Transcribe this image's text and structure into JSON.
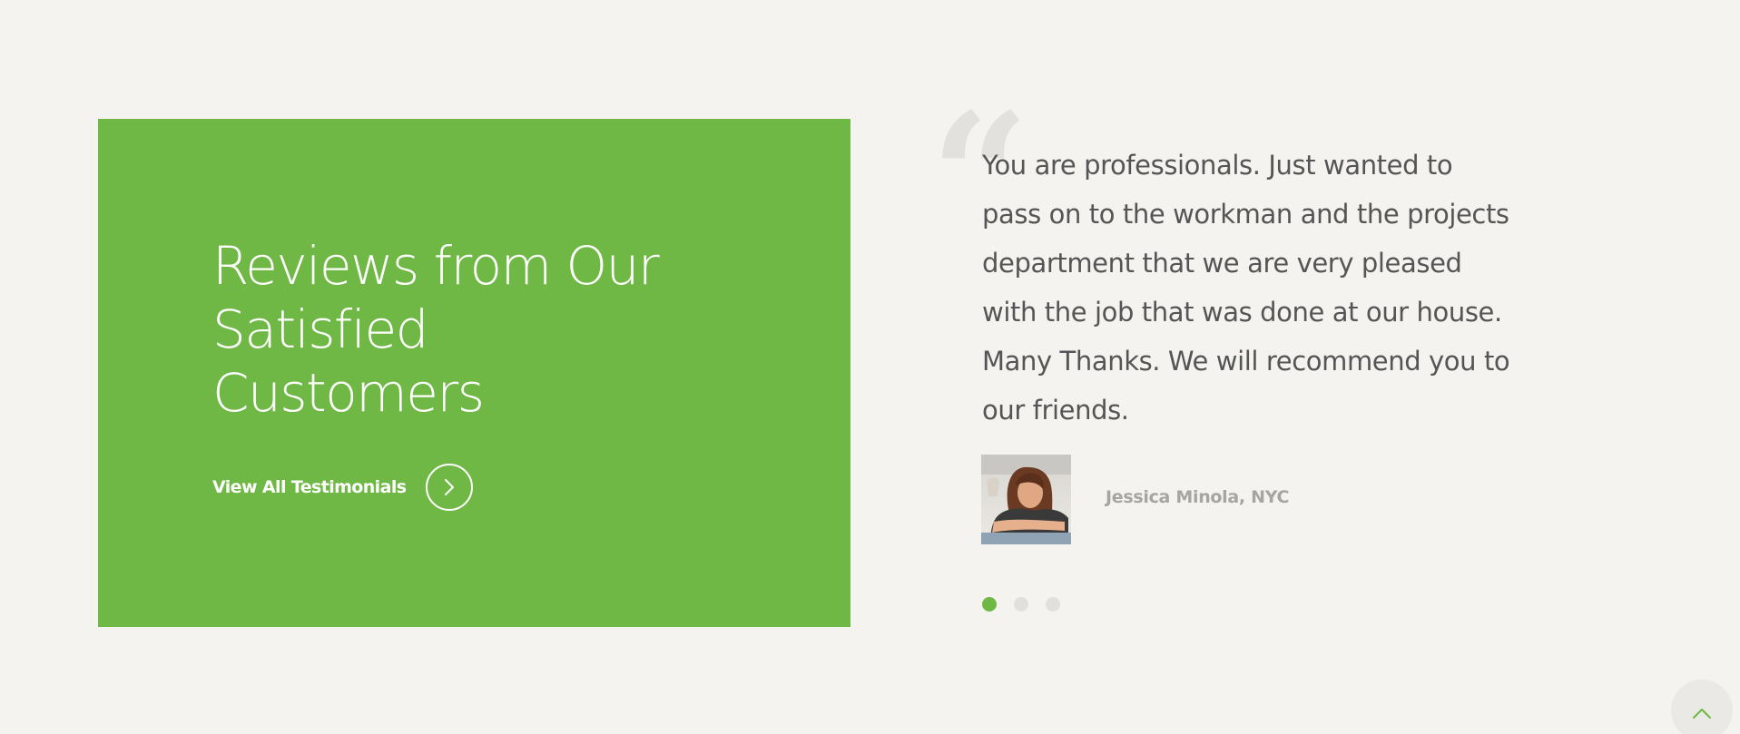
{
  "colors": {
    "page_background": "#f4f3f0",
    "accent_green": "#70b845",
    "quote_text": "#555555",
    "author_text": "#a6a5a1",
    "inactive_dot": "#e1e0dc"
  },
  "promo": {
    "title_lines": [
      "Reviews from Our",
      "Satisfied",
      "Customers"
    ],
    "link_label": "View All Testimonials",
    "link_icon": "chevron-right-icon"
  },
  "testimonial": {
    "quote_icon": "quote-icon",
    "text": "You are professionals. Just wanted to pass on to the workman and the projects department that we are very pleased with the job that was done at our house. Many Thanks. We will recommend you to our friends.",
    "author": "Jessica Minola, NYC",
    "photo_icon": "customer-avatar"
  },
  "carousel": {
    "total_slides": 3,
    "active_slide": 1
  },
  "back_to_top": {
    "icon": "chevron-up-icon"
  }
}
